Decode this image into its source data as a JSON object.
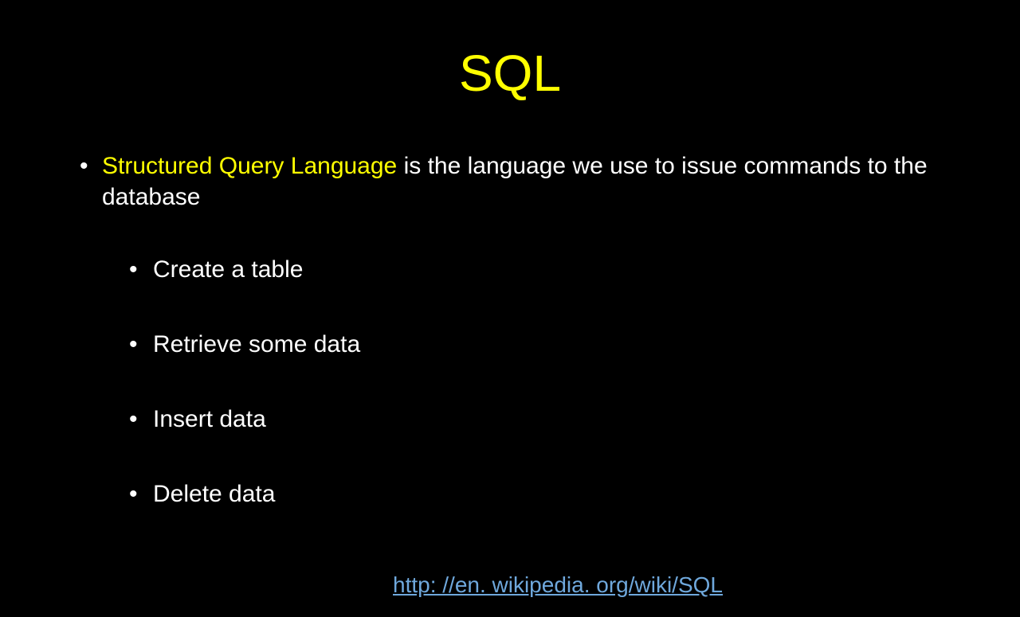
{
  "title": "SQL",
  "main_bullet": {
    "highlight": "Structured Query Language",
    "rest": " is the language we use to issue commands to the database"
  },
  "sub_bullets": [
    "Create a table",
    "Retrieve some data",
    "Insert data",
    "Delete data"
  ],
  "link": "http: //en. wikipedia. org/wiki/SQL"
}
